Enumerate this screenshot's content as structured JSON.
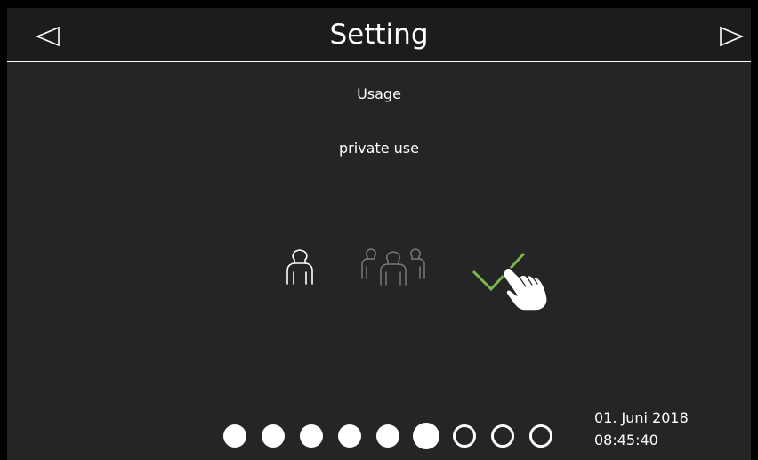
{
  "header": {
    "title": "Setting",
    "prev_icon": "triangle-left-icon",
    "next_icon": "triangle-right-icon"
  },
  "main": {
    "section_label": "Usage",
    "value_label": "private use",
    "options": [
      {
        "name": "single-user",
        "icon": "single-person-icon",
        "selected": true
      },
      {
        "name": "multi-user",
        "icon": "group-people-icon",
        "selected": false
      },
      {
        "name": "confirm",
        "icon": "checkmark-icon"
      }
    ],
    "tap_hint_icon": "tap-hand-icon"
  },
  "pagination": {
    "total": 9,
    "current": 6,
    "filled_through": 6
  },
  "status": {
    "date": "01. Juni 2018",
    "time": "08:45:40"
  },
  "colors": {
    "background": "#252525",
    "header_background": "#1c1c1c",
    "text": "#ffffff",
    "inactive_icon": "#7a7a7a",
    "confirm": "#7ab84a"
  }
}
